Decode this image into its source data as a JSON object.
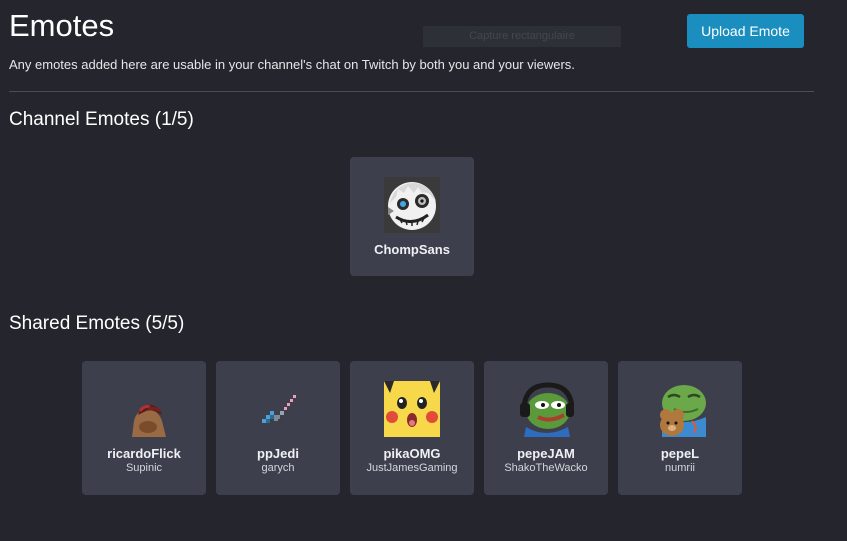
{
  "header": {
    "title": "Emotes",
    "subtitle": "Any emotes added here are usable in your channel's chat on Twitch by both you and your viewers.",
    "capture_overlay": "Capture rectangulaire",
    "upload_label": "Upload Emote"
  },
  "channel": {
    "heading": "Channel Emotes (1/5)",
    "emotes": [
      {
        "name": "ChompSans",
        "icon": "chompsans-emote-icon"
      }
    ]
  },
  "shared": {
    "heading": "Shared Emotes (5/5)",
    "emotes": [
      {
        "name": "ricardoFlick",
        "owner": "Supinic",
        "icon": "ricardoflick-emote-icon"
      },
      {
        "name": "ppJedi",
        "owner": "garych",
        "icon": "ppjedi-emote-icon"
      },
      {
        "name": "pikaOMG",
        "owner": "JustJamesGaming",
        "icon": "pikaomg-emote-icon"
      },
      {
        "name": "pepeJAM",
        "owner": "ShakoTheWacko",
        "icon": "pepejam-emote-icon"
      },
      {
        "name": "pepeL",
        "owner": "numrii",
        "icon": "pepel-emote-icon"
      }
    ]
  },
  "colors": {
    "background": "#25262d",
    "card": "#3d404c",
    "accent": "#1a8fbf"
  }
}
